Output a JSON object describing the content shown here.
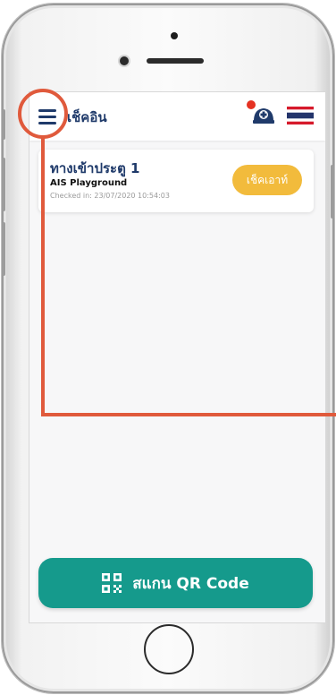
{
  "app": {
    "title": "เช็คอิน"
  },
  "checkin_card": {
    "gate": "ทางเข้าประตู 1",
    "place": "AIS Playground",
    "checked_in": "Checked in: 23/07/2020 10:54:03",
    "checkout_label": "เช็คเอาท์"
  },
  "scan_button": {
    "label": "สแกน QR Code"
  },
  "icons": {
    "menu": "hamburger-menu-icon",
    "nurse": "nurse-cap-icon",
    "flag": "thai-flag-icon",
    "qr": "qr-code-icon"
  },
  "colors": {
    "primary": "#1f3a6a",
    "checkout": "#f2bb3c",
    "scan": "#159a8c",
    "annotation": "#e05a3c",
    "notification_dot": "#e53222"
  }
}
